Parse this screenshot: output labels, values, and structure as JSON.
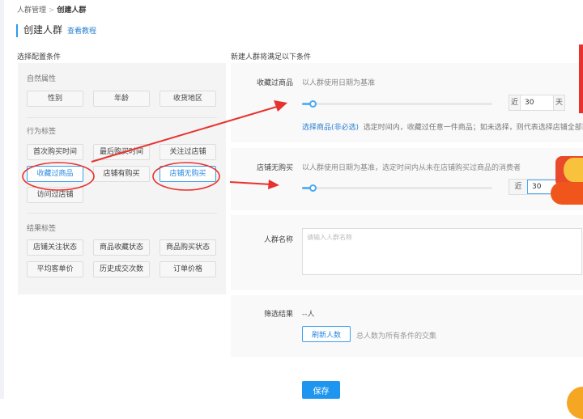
{
  "breadcrumb": {
    "parent": "人群管理",
    "sep": ">",
    "current": "创建人群"
  },
  "page": {
    "title": "创建人群",
    "tutorial_link": "查看教程"
  },
  "left": {
    "heading": "选择配置条件",
    "sections": [
      {
        "title": "自然属性",
        "items": [
          "性别",
          "年龄",
          "收货地区"
        ]
      },
      {
        "title": "行为标签",
        "items": [
          "首次购买时间",
          "最后购买时间",
          "关注过店铺",
          "收藏过商品",
          "店铺有购买",
          "店铺无购买",
          "访问过店铺"
        ]
      },
      {
        "title": "结果标签",
        "items": [
          "店铺关注状态",
          "商品收藏状态",
          "商品购买状态",
          "平均客单价",
          "历史成交次数",
          "订单价格"
        ]
      }
    ]
  },
  "right": {
    "heading": "新建人群将满足以下条件",
    "cond1": {
      "label": "收藏过商品",
      "hint": "以人群使用日期为基准",
      "prefix": "近",
      "value": "30",
      "suffix": "天",
      "slider_fraction": 0.06,
      "select_link": "选择商品(非必选)",
      "desc": "选定时间内，收藏过任意一件商品；如未选择，则代表选择店铺全部商品"
    },
    "cond2": {
      "label": "店铺无购买",
      "hint": "以人群使用日期为基准，选定时间内从未在店铺购买过商品的消费者",
      "prefix": "近",
      "value": "30",
      "slider_fraction": 0.06
    },
    "name": {
      "label": "人群名称",
      "placeholder": "请输入人群名称"
    },
    "result": {
      "label": "筛选结果",
      "value": "--人",
      "refresh": "刷新人数",
      "note": "总人数为所有条件的交集"
    }
  },
  "save": "保存",
  "colors": {
    "accent": "#1e96ef",
    "annotation": "#e8322e"
  }
}
